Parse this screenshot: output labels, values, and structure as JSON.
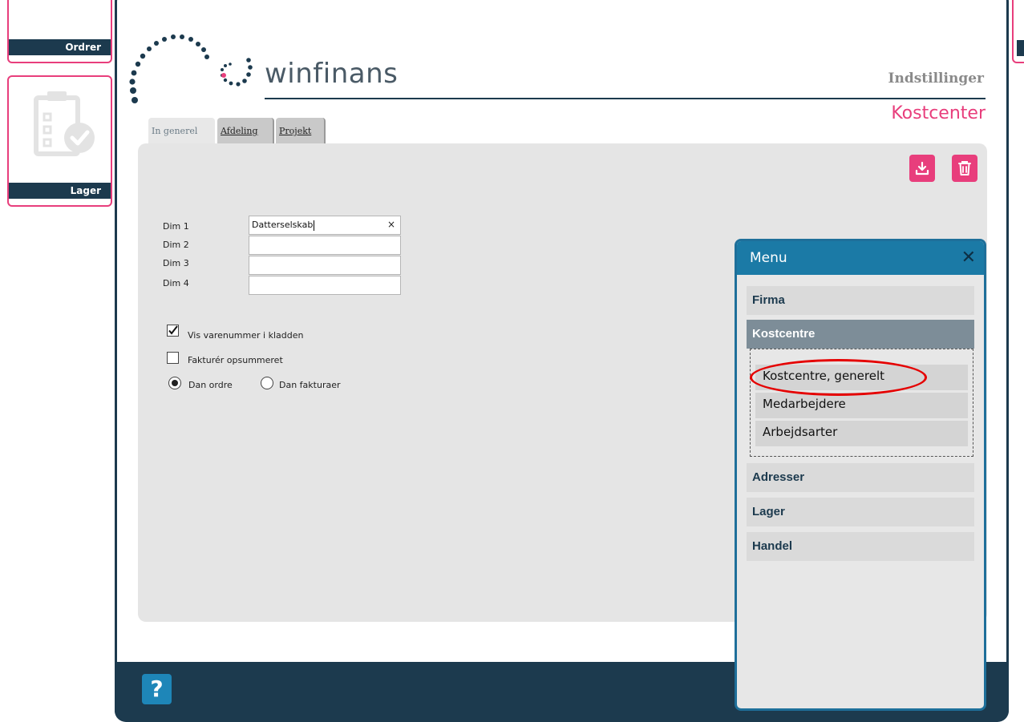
{
  "tiles": {
    "ordrer_label": "Ordrer",
    "lager_label": "Lager"
  },
  "header": {
    "brand": "winfinans",
    "settings_label": "Indstillinger",
    "section_title": "Kostcenter"
  },
  "tabs": [
    {
      "label": "In generel",
      "active": true
    },
    {
      "label": "Afdeling",
      "active": false
    },
    {
      "label": "Projekt",
      "active": false
    }
  ],
  "form": {
    "dim1_label": "Dim 1",
    "dim1_value": "Datterselskab",
    "dim2_label": "Dim 2",
    "dim2_value": "",
    "dim3_label": "Dim 3",
    "dim3_value": "",
    "dim4_label": "Dim 4",
    "dim4_value": "",
    "clear_glyph": "×",
    "check_vis_label": "Vis varenummer i kladden",
    "check_vis_checked": true,
    "check_fakturer_label": "Fakturér opsummeret",
    "check_fakturer_checked": false,
    "radio_dan_ordre_label": "Dan ordre",
    "radio_dan_fakturaer_label": "Dan fakturaer",
    "radio_selected": "Dan ordre"
  },
  "menu": {
    "title": "Menu",
    "close_glyph": "✕",
    "items": {
      "firma": "Firma",
      "kostcentre": "Kostcentre",
      "adresser": "Adresser",
      "lager": "Lager",
      "handel": "Handel"
    },
    "subitems": {
      "generelt": "Kostcentre, generelt",
      "medarbejdere": "Medarbejdere",
      "arbejdsarter": "Arbejdsarter"
    }
  },
  "footer": {
    "help_glyph": "?"
  },
  "colors": {
    "accent": "#e83e7c",
    "navy": "#1c3a4e",
    "menu_header": "#1b7aa6",
    "highlight": "#e50000"
  },
  "icons": [
    "clipboard-check-icon",
    "download-icon",
    "trash-icon",
    "close-icon",
    "help-icon",
    "checkbox-checked-icon",
    "radio-selected-icon",
    "winfinans-logo-icon"
  ]
}
